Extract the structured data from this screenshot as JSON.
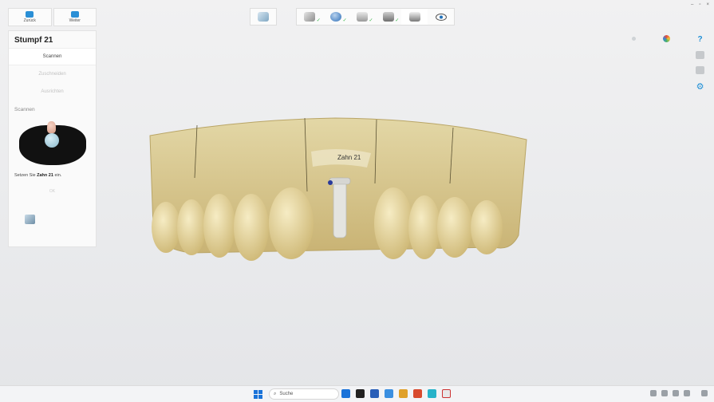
{
  "nav": {
    "back_label": "Zurück",
    "next_label": "Weiter"
  },
  "panel": {
    "title": "Stumpf 21",
    "steps": [
      "Scannen",
      "Zuschneiden",
      "Ausrichten"
    ],
    "section_label": "Scannen",
    "hint_prefix": "Setzen Sie ",
    "hint_bold": "Zahn 21",
    "hint_suffix": " ein.",
    "ok_label": "OK"
  },
  "toolbar": {
    "buttons": [
      {
        "icon": "upper-jaw-scan-icon",
        "done": true
      },
      {
        "icon": "lower-jaw-scan-icon",
        "done": true
      },
      {
        "icon": "bite-scan-icon",
        "done": true
      },
      {
        "icon": "model-scan-icon",
        "done": true
      },
      {
        "icon": "stump-scan-icon",
        "done": false,
        "active": true
      },
      {
        "icon": "view-eye-icon",
        "done": false
      }
    ],
    "check_glyph": "✓"
  },
  "model": {
    "tooth_label": "Zahn 21"
  },
  "right": {
    "help": "?",
    "settings": "⚙"
  },
  "window": {
    "minimize": "–",
    "restore": "▫",
    "close": "×"
  },
  "taskbar": {
    "search_placeholder": "Suche"
  },
  "colors": {
    "accent": "#1f8fd6",
    "check": "#3ab54a",
    "model": "#d9c68a"
  }
}
